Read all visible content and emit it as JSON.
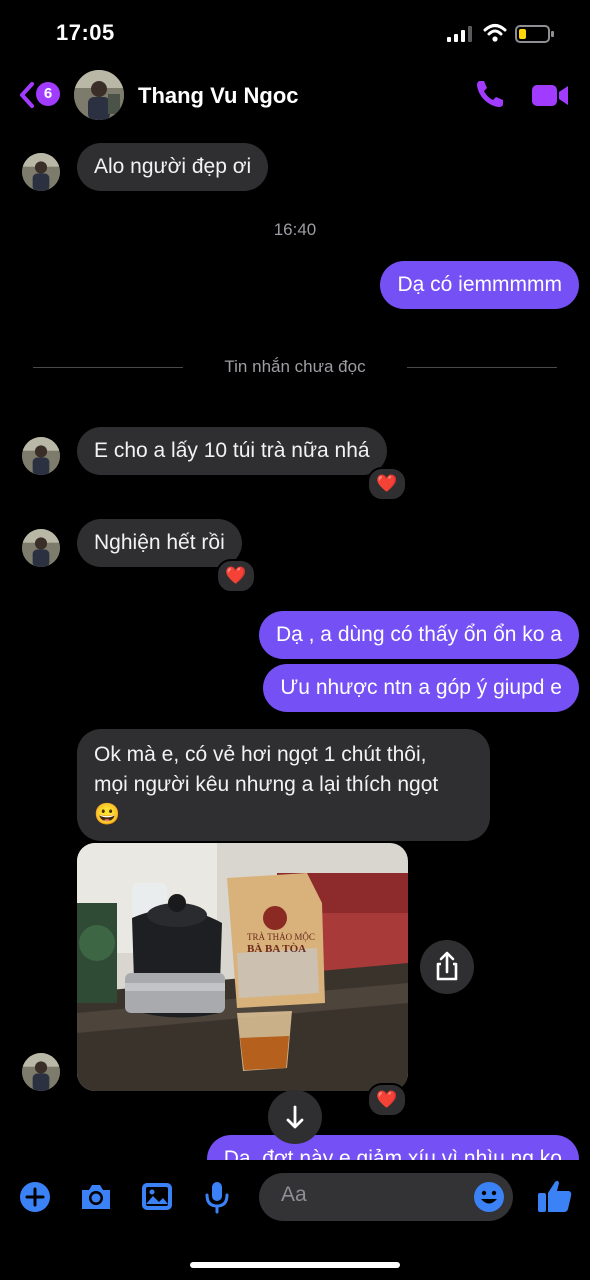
{
  "status_bar": {
    "time": "17:05"
  },
  "header": {
    "back_count": "6",
    "contact_name": "Thang Vu Ngoc"
  },
  "messages": {
    "m1": "Alo người đẹp ơi",
    "timestamp": "16:40",
    "m2": "Dạ có iemmmmm",
    "unread_divider": "Tin nhắn chưa đọc",
    "m3": "E cho a lấy 10 túi trà nữa nhá",
    "m4": "Nghiện hết rồi",
    "m5": "Dạ , a dùng có thấy ổn ổn ko a",
    "m6": "Ưu nhược ntn a góp ý giupd e",
    "m7_line1": "Ok mà e, có vẻ hơi ngọt 1 chút thôi,",
    "m7_line2": "mọi người kêu nhưng a lại thích ngọt",
    "m7_emoji": "😀",
    "m8": "Dạ, đợt này e giảm xíu vì nhìu ng ko"
  },
  "reaction": "❤️",
  "photo": {
    "bag_line1": "TRÀ THẢO MỘC",
    "bag_line2": "BÀ BA TÒA"
  },
  "composer": {
    "placeholder": "Aa"
  },
  "colors": {
    "accent": "#a13bff",
    "outgoing_bubble": "#7550f4",
    "incoming_bubble": "#2f2f31",
    "toolbar_blue": "#3b82f6"
  }
}
